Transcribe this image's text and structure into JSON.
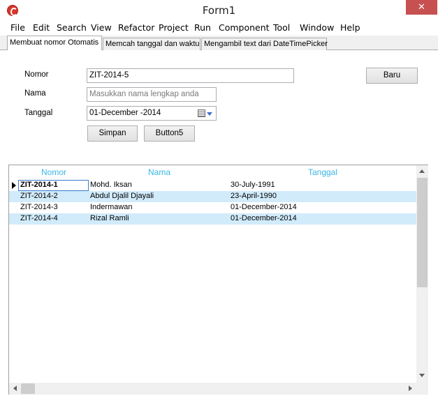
{
  "window": {
    "title": "Form1",
    "close_glyph": "✕"
  },
  "menu": [
    "File",
    "Edit",
    "Search",
    "View",
    "Refactor",
    "Project",
    "Run",
    "Component",
    "Tool",
    "Window",
    "Help"
  ],
  "tabs": [
    {
      "label": "Membuat nomor Otomatis",
      "active": true
    },
    {
      "label": "Memcah tanggal dan waktu",
      "active": false
    },
    {
      "label": "Mengambil text dari DateTimePicker",
      "active": false
    }
  ],
  "form": {
    "nomor_label": "Nomor",
    "nomor_value": "ZIT-2014-5",
    "nama_label": "Nama",
    "nama_placeholder": "Masukkan nama lengkap anda",
    "tanggal_label": "Tanggal",
    "tanggal_value": "01-December -2014",
    "baru_label": "Baru",
    "simpan_label": "Simpan",
    "button5_label": "Button5"
  },
  "grid": {
    "columns": [
      "Nomor",
      "Nama",
      "Tanggal"
    ],
    "rows": [
      {
        "nomor": "ZIT-2014-1",
        "nama": "Mohd. Iksan",
        "tanggal": "30-July-1991"
      },
      {
        "nomor": "ZIT-2014-2",
        "nama": "Abdul Djalil Djayali",
        "tanggal": "23-April-1990"
      },
      {
        "nomor": "ZIT-2014-3",
        "nama": "Indermawan",
        "tanggal": "01-December-2014"
      },
      {
        "nomor": "ZIT-2014-4",
        "nama": "Rizal Ramli",
        "tanggal": "01-December-2014"
      }
    ],
    "header_color": "#39b5e6",
    "alt_row_color": "#d1ebfb"
  },
  "icons": {
    "app": "app-logo-icon",
    "calendar": "calendar-icon",
    "dropdown": "chevron-down-icon",
    "row_indicator": "row-pointer-icon"
  }
}
